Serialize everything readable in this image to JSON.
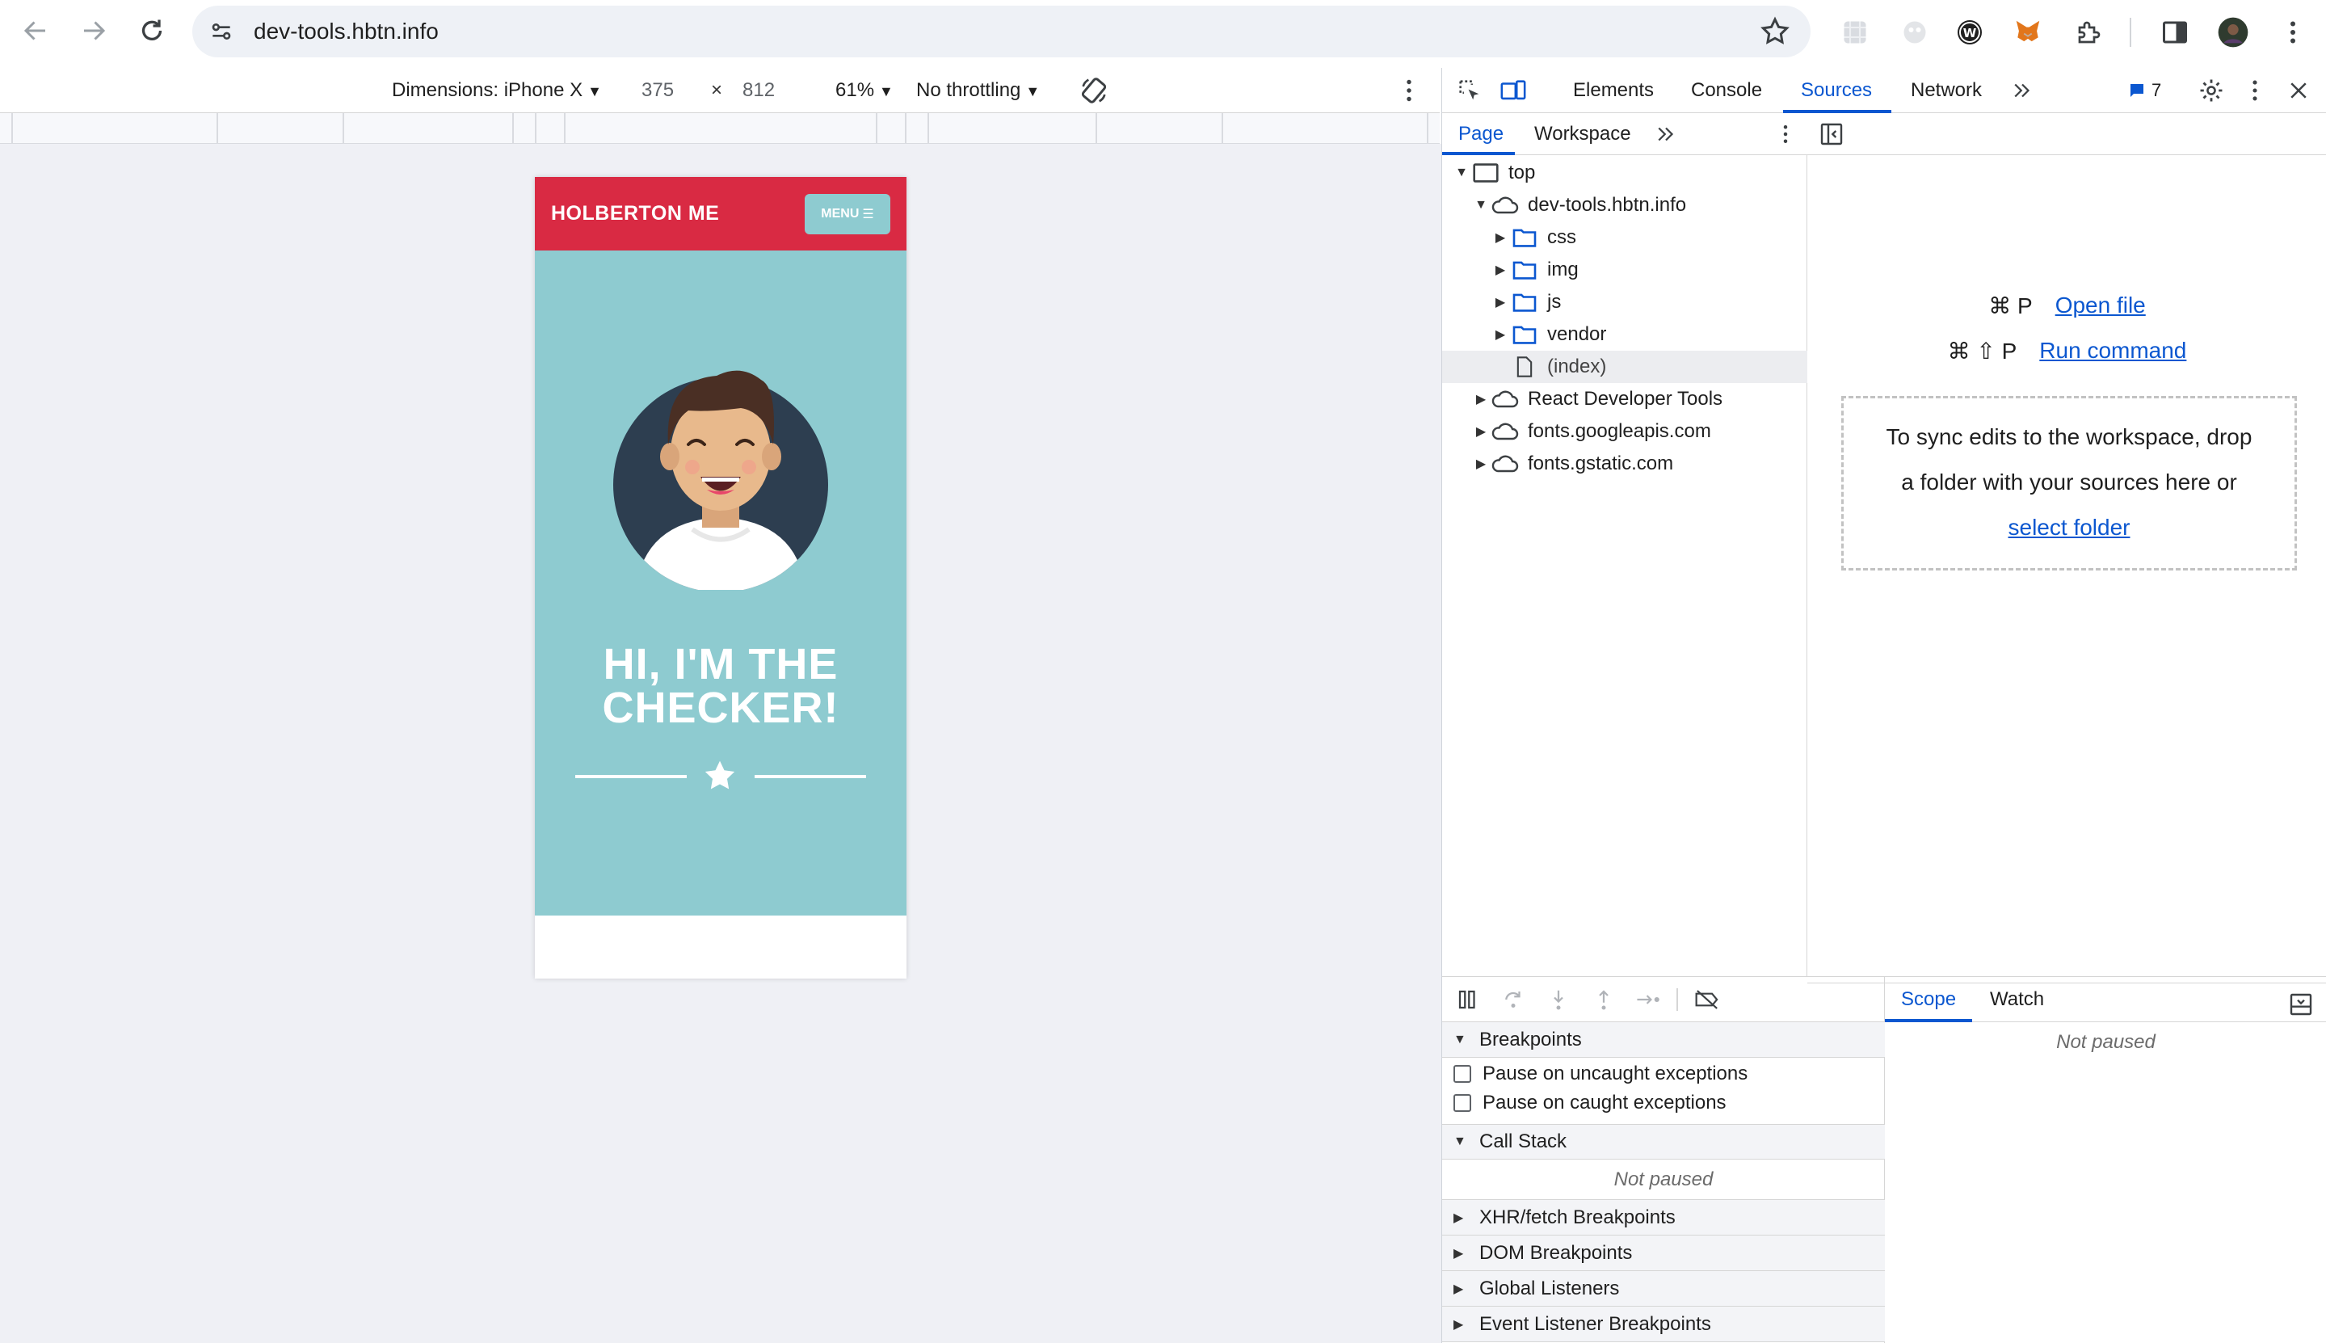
{
  "browser": {
    "url": "dev-tools.hbtn.info",
    "back_icon": "arrow-left-icon",
    "forward_icon": "arrow-right-icon",
    "reload_icon": "reload-icon"
  },
  "device_toolbar": {
    "dimensions_label": "Dimensions: iPhone X",
    "width": "375",
    "times": "×",
    "height": "812",
    "zoom": "61%",
    "throttling": "No throttling"
  },
  "phone": {
    "brand": "HOLBERTON ME",
    "menu_label": "MENU",
    "menu_icon": "☰",
    "hero_title_line1": "HI, I'M THE",
    "hero_title_line2": "CHECKER!",
    "colors": {
      "header": "#d92a43",
      "hero": "#8ecbd0"
    }
  },
  "devtools": {
    "tabs": [
      "Elements",
      "Console",
      "Sources",
      "Network"
    ],
    "active_tab": "Sources",
    "issues_count": "7",
    "navigator_tabs": [
      "Page",
      "Workspace"
    ],
    "tree": [
      {
        "label": "top",
        "kind": "frame",
        "expanded": true
      },
      {
        "label": "dev-tools.hbtn.info",
        "kind": "cloud",
        "expanded": true
      },
      {
        "label": "css",
        "kind": "folder"
      },
      {
        "label": "img",
        "kind": "folder"
      },
      {
        "label": "js",
        "kind": "folder"
      },
      {
        "label": "vendor",
        "kind": "folder"
      },
      {
        "label": "(index)",
        "kind": "file",
        "selected": true
      },
      {
        "label": "React Developer Tools",
        "kind": "cloud"
      },
      {
        "label": "fonts.googleapis.com",
        "kind": "cloud"
      },
      {
        "label": "fonts.gstatic.com",
        "kind": "cloud"
      }
    ],
    "editor": {
      "open_file_shortcut": "⌘ P",
      "open_file_label": "Open file",
      "run_command_shortcut": "⌘ ⇧ P",
      "run_command_label": "Run command",
      "drop_text_line1": "To sync edits to the workspace, drop",
      "drop_text_line2": "a folder with your sources here or",
      "select_folder_label": "select folder"
    },
    "debugger": {
      "breakpoints_label": "Breakpoints",
      "pause_uncaught": "Pause on uncaught exceptions",
      "pause_caught": "Pause on caught exceptions",
      "call_stack_label": "Call Stack",
      "not_paused": "Not paused",
      "sections": [
        "XHR/fetch Breakpoints",
        "DOM Breakpoints",
        "Global Listeners",
        "Event Listener Breakpoints"
      ],
      "scope_tab": "Scope",
      "watch_tab": "Watch",
      "scope_not_paused": "Not paused"
    },
    "accent_color": "#0b57d0"
  }
}
